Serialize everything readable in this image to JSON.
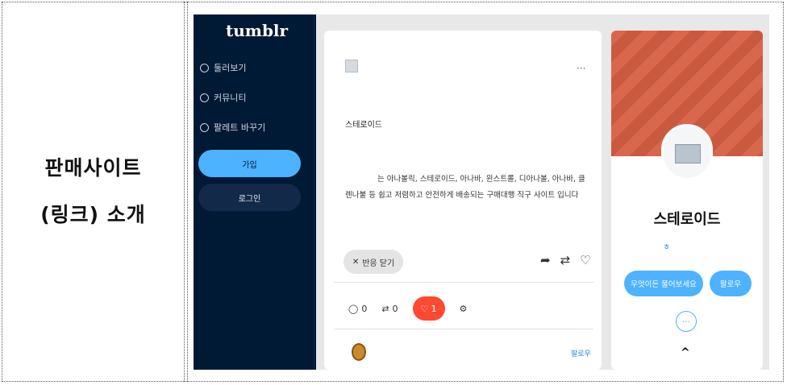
{
  "caption": {
    "line1": "판매사이트",
    "line2": "(링크) 소개"
  },
  "sidebar": {
    "logo": "tumblr",
    "items": [
      {
        "label": "둘러보기",
        "icon": "compass-icon"
      },
      {
        "label": "커뮤니티",
        "icon": "community-icon"
      },
      {
        "label": "팔레트 바꾸기",
        "icon": "palette-icon"
      }
    ],
    "join_label": "가입",
    "login_label": "로그인"
  },
  "post": {
    "more": "···",
    "title": "스테로이드",
    "body": "는 아나볼릭, 스테로이드, 아나바, 윈스트롤, 디아나볼, 아나바, 클렌나불 등 쉽고 저렴하고 안전하게 배송되는 구매대행 직구 사이트 입니다",
    "close_chip": "반응 닫기",
    "comments": "0",
    "reblogs": "0",
    "likes": "1",
    "follow_label": "팔로우"
  },
  "profile": {
    "name": "스테로이드",
    "handle": "ㅎ",
    "ask_label": "무엇이든 물어보세요",
    "follow_label": "팔로우",
    "more": "···",
    "collapse": "^"
  },
  "colors": {
    "sidebar_bg": "#001935",
    "accent": "#4db2ff",
    "like": "#ff4930",
    "banner": "#d9674b"
  }
}
